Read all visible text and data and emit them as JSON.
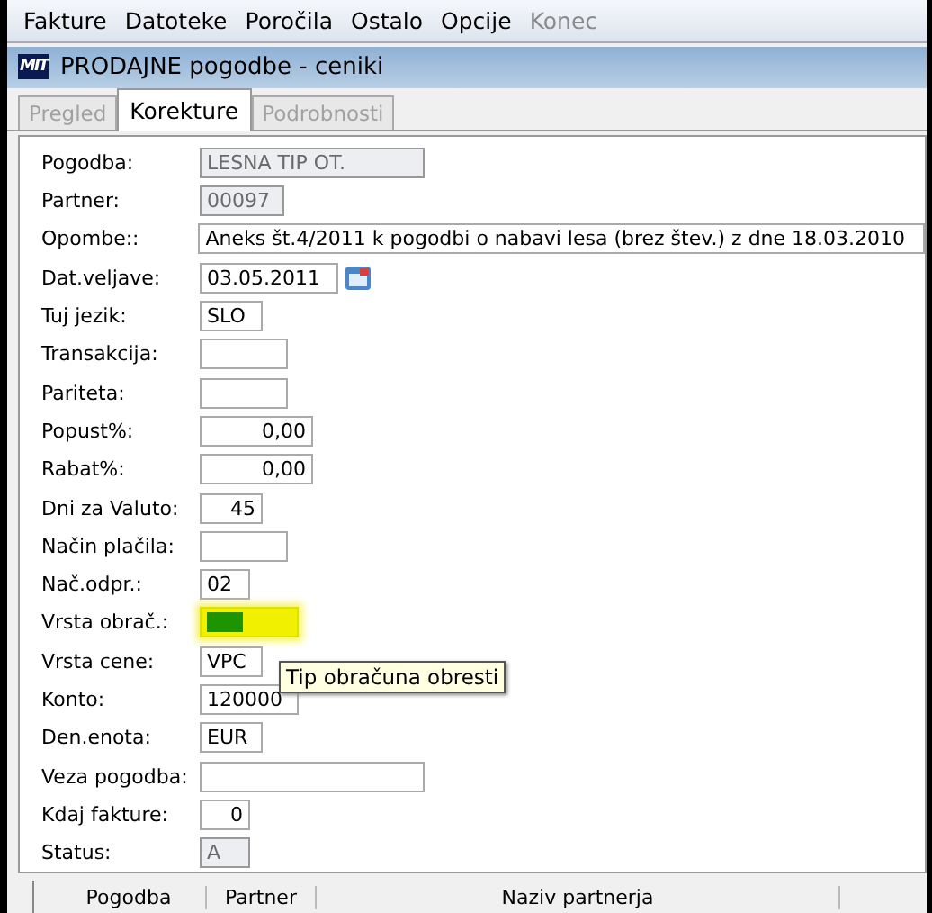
{
  "menu": [
    {
      "label": "Fakture",
      "disabled": false
    },
    {
      "label": "Datoteke",
      "disabled": false
    },
    {
      "label": "Poročila",
      "disabled": false
    },
    {
      "label": "Ostalo",
      "disabled": false
    },
    {
      "label": "Opcije",
      "disabled": false
    },
    {
      "label": "Konec",
      "disabled": true
    }
  ],
  "window": {
    "title": "PRODAJNE pogodbe - ceniki",
    "logo": "MIT"
  },
  "tabs": [
    {
      "label": "Pregled",
      "selected": false,
      "disabled": true
    },
    {
      "label": "Korekture",
      "selected": true,
      "disabled": false
    },
    {
      "label": "Podrobnosti",
      "selected": false,
      "disabled": true
    }
  ],
  "fields": [
    {
      "label": "Pogodba:",
      "value": "LESNA TIP OT.",
      "kind": "readonly"
    },
    {
      "label": "Partner:",
      "value": "00097",
      "kind": "readonly"
    },
    {
      "label": "Opombe::",
      "value": "Aneks št.4/2011 k pogodbi o nabavi lesa (brez štev.) z dne 18.03.2010",
      "kind": "text"
    },
    {
      "label": "Dat.veljave:",
      "value": "03.05.2011",
      "kind": "date"
    },
    {
      "label": "Tuj jezik:",
      "value": "SLO",
      "kind": "text"
    },
    {
      "label": "Transakcija:",
      "kind": "text"
    },
    {
      "label": "Pariteta:",
      "kind": "text"
    },
    {
      "label": "Popust%:",
      "value": "0,00",
      "kind": "number"
    },
    {
      "label": "Rabat%:",
      "value": "0,00",
      "kind": "number"
    },
    {
      "label": "Dni za Valuto:",
      "value": "45",
      "kind": "number"
    },
    {
      "label": "Način plačila:",
      "kind": "text"
    },
    {
      "label": "Nač.odpr.:",
      "value": "02",
      "kind": "text"
    },
    {
      "label": "Vrsta obrač.:",
      "kind": "color",
      "color": "#1e9400",
      "highlighted": true
    },
    {
      "label": "Vrsta cene:",
      "value": "VPC",
      "kind": "text"
    },
    {
      "label": "Konto:",
      "value": "120000",
      "kind": "text"
    },
    {
      "label": "Den.enota:",
      "value": "EUR",
      "kind": "text"
    },
    {
      "label": "Veza pogodba:",
      "kind": "text"
    },
    {
      "label": "Kdaj fakture:",
      "value": "0",
      "kind": "number"
    },
    {
      "label": "Status:",
      "value": "A",
      "kind": "readonly"
    }
  ],
  "tooltip": {
    "text": "Tip obračuna obresti"
  },
  "table": {
    "columns": [
      "Pogodba",
      "Partner",
      "Naziv partnerja"
    ]
  }
}
